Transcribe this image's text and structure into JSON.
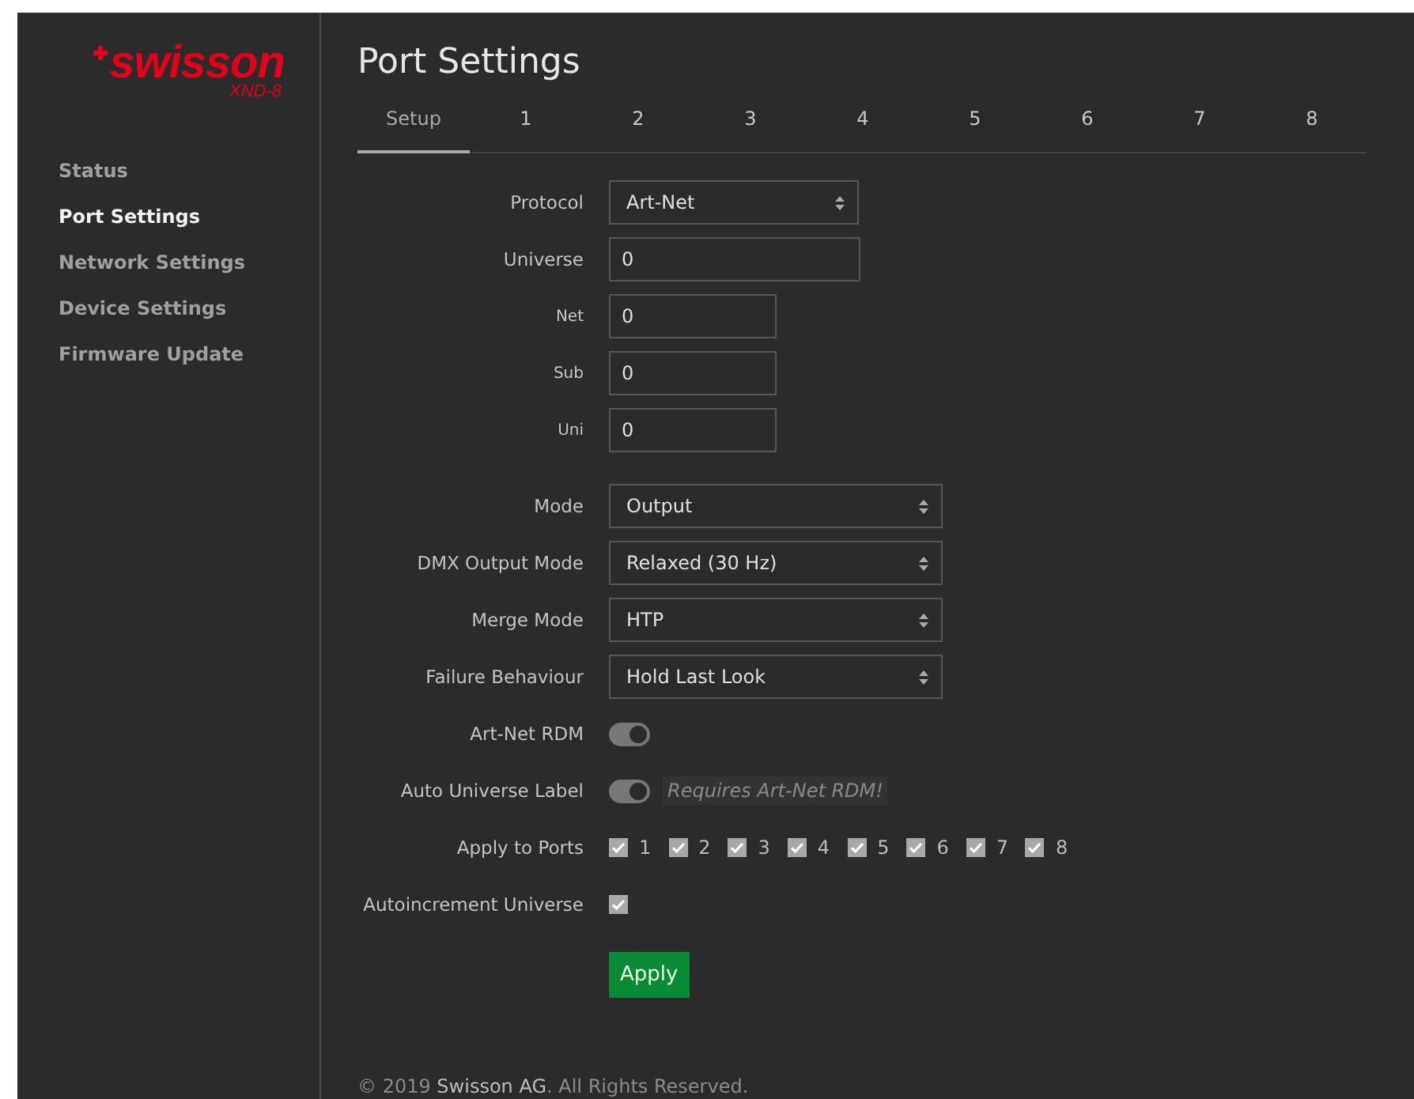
{
  "sidebar": {
    "logo": "swisson",
    "model": "XND-8",
    "items": [
      {
        "label": "Status",
        "selected": false
      },
      {
        "label": "Port Settings",
        "selected": true
      },
      {
        "label": "Network Settings",
        "selected": false
      },
      {
        "label": "Device Settings",
        "selected": false
      },
      {
        "label": "Firmware Update",
        "selected": false
      }
    ]
  },
  "page": {
    "title": "Port Settings"
  },
  "tabs": [
    {
      "label": "Setup",
      "selected": true
    },
    {
      "label": "1",
      "selected": false
    },
    {
      "label": "2",
      "selected": false
    },
    {
      "label": "3",
      "selected": false
    },
    {
      "label": "4",
      "selected": false
    },
    {
      "label": "5",
      "selected": false
    },
    {
      "label": "6",
      "selected": false
    },
    {
      "label": "7",
      "selected": false
    },
    {
      "label": "8",
      "selected": false
    }
  ],
  "form": {
    "sections": [
      {
        "rows": [
          {
            "kind": "short_select",
            "label": "Protocol",
            "value": "Art-Net"
          },
          {
            "kind": "input",
            "label": "Universe",
            "value": "0"
          },
          {
            "kind": "sub_input",
            "label": "Net",
            "value": "0"
          },
          {
            "kind": "sub_input",
            "label": "Sub",
            "value": "0"
          },
          {
            "kind": "sub_input",
            "label": "Uni",
            "value": "0"
          }
        ]
      },
      {
        "rows": [
          {
            "kind": "select",
            "label": "Mode",
            "value": "Output"
          },
          {
            "kind": "select",
            "label": "DMX Output Mode",
            "value": "Relaxed (30 Hz)"
          },
          {
            "kind": "select",
            "label": "Merge Mode",
            "value": "HTP"
          },
          {
            "kind": "select",
            "label": "Failure Behaviour",
            "value": "Hold Last Look"
          },
          {
            "kind": "toggle",
            "label": "Art-Net RDM",
            "on": true
          },
          {
            "kind": "toggle",
            "label": "Auto Universe Label",
            "on": true,
            "hint": "Requires Art-Net RDM!"
          },
          {
            "kind": "checkboxes",
            "label": "Apply to Ports",
            "options": [
              {
                "label": "1",
                "checked": true
              },
              {
                "label": "2",
                "checked": true
              },
              {
                "label": "3",
                "checked": true
              },
              {
                "label": "4",
                "checked": true
              },
              {
                "label": "5",
                "checked": true
              },
              {
                "label": "6",
                "checked": true
              },
              {
                "label": "7",
                "checked": true
              },
              {
                "label": "8",
                "checked": true
              }
            ]
          },
          {
            "kind": "checkbox",
            "label": "Autoincrement Universe",
            "checked": true
          }
        ]
      }
    ],
    "submit": "Apply"
  },
  "footer": {
    "prefix": "© 2019 ",
    "link": "Swisson AG",
    "suffix": ". All Rights Reserved."
  }
}
